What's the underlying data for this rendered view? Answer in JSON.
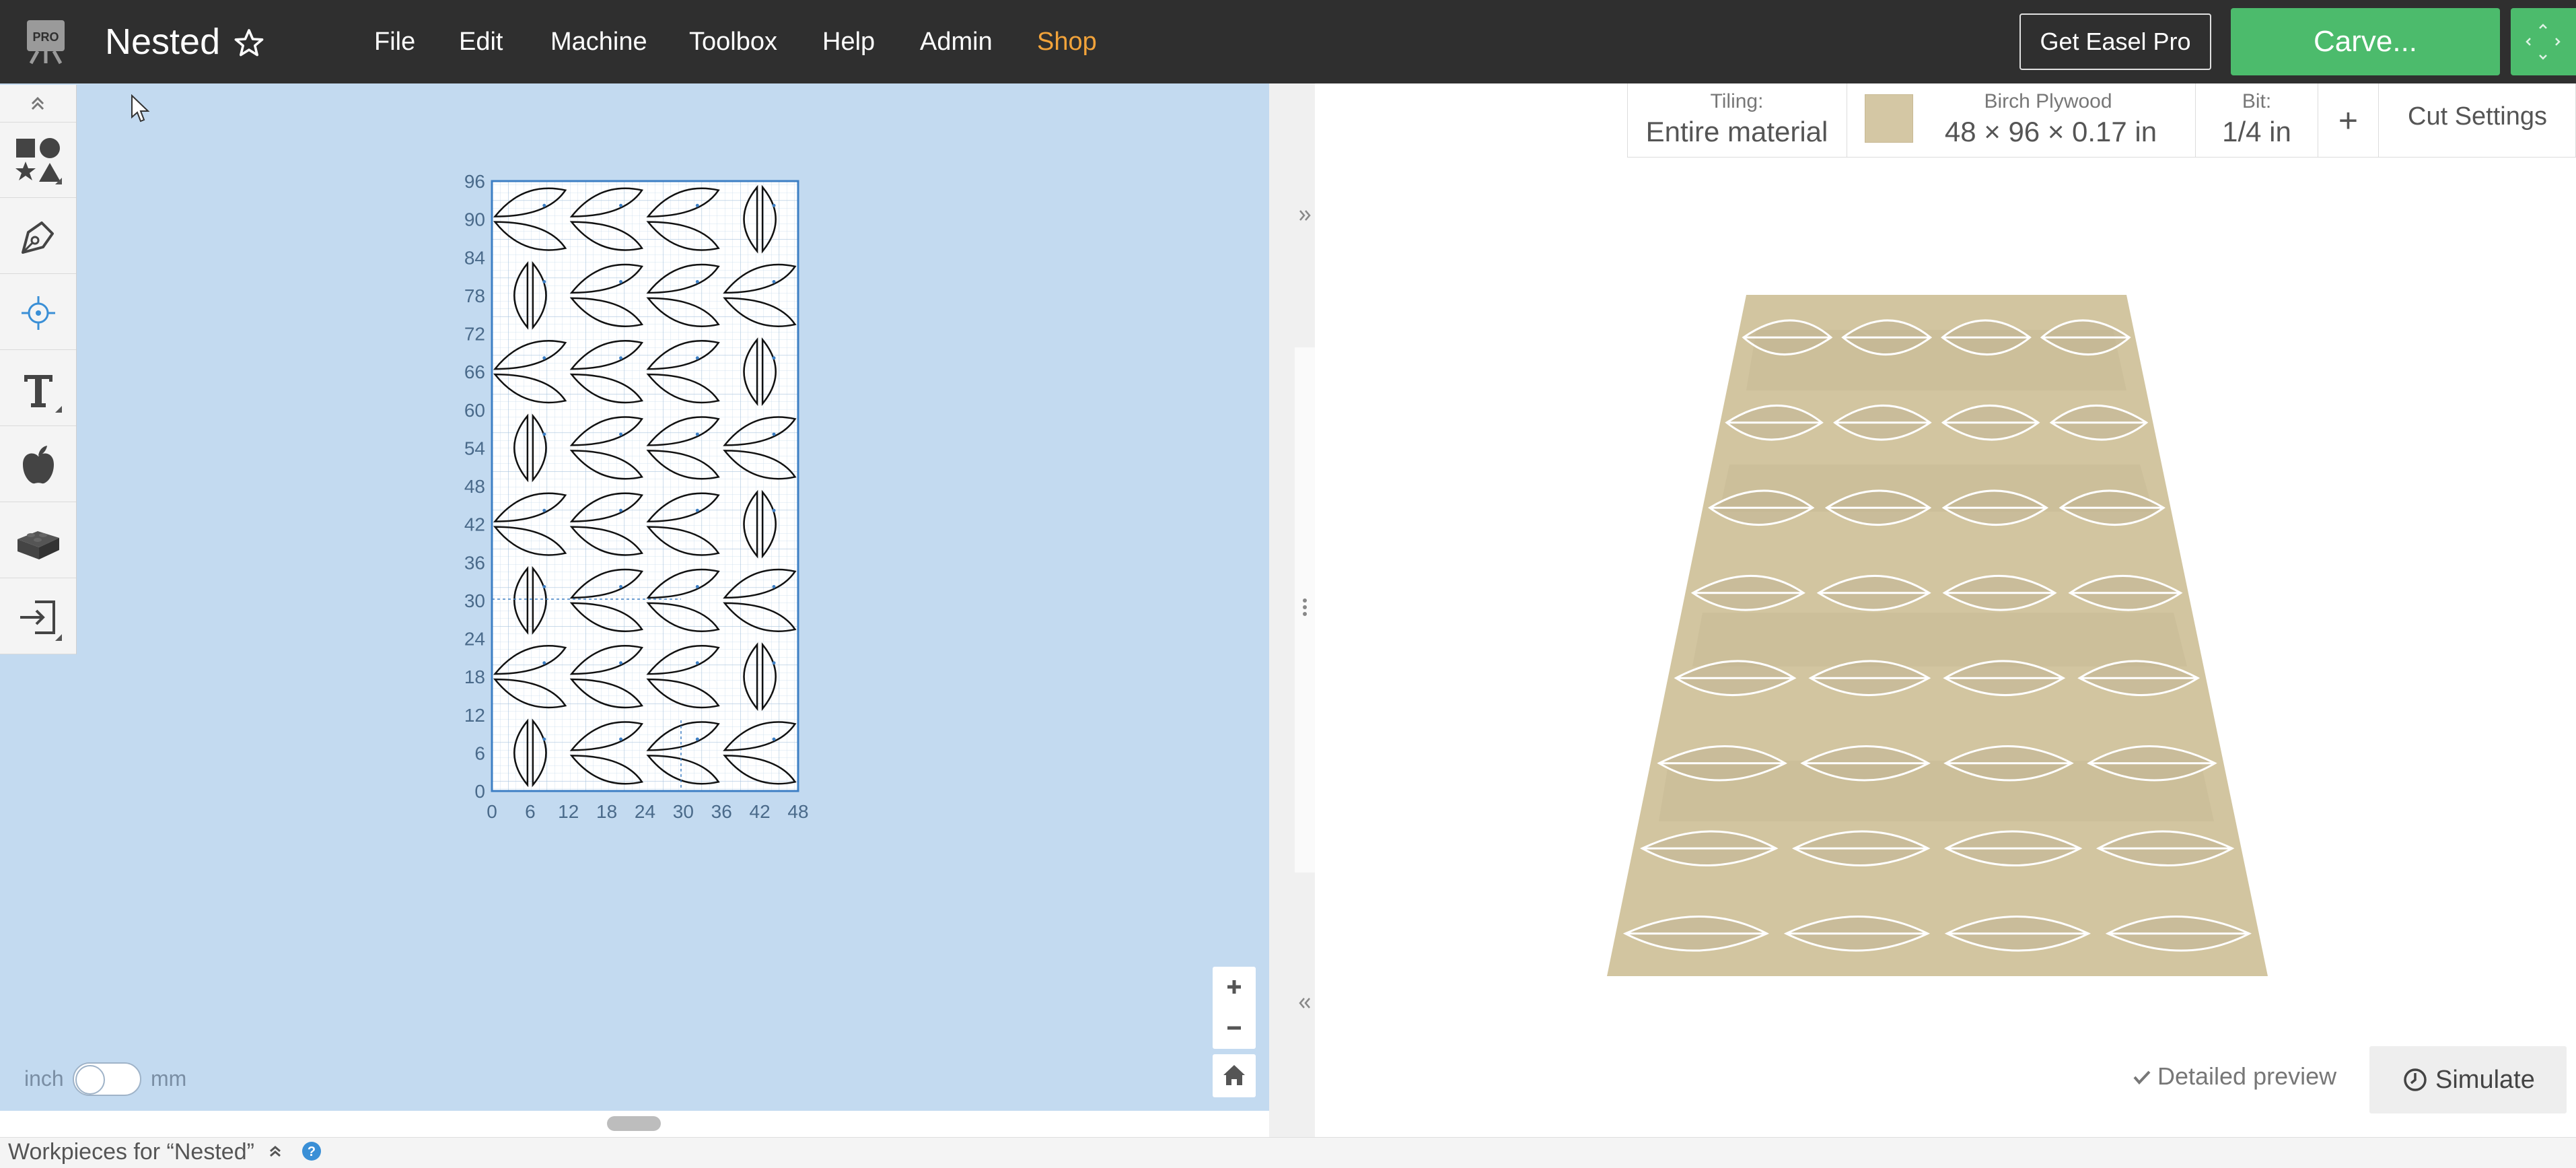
{
  "header": {
    "logo_badge": "PRO",
    "title": "Nested",
    "menu": [
      "File",
      "Edit",
      "Machine",
      "Toolbox",
      "Help",
      "Admin",
      "Shop"
    ],
    "get_pro_label": "Get Easel Pro",
    "carve_label": "Carve..."
  },
  "toolbar": {
    "tools": [
      "shapes-icon",
      "pen-icon",
      "point-icon",
      "text-icon",
      "apple-icon",
      "lego-block-icon",
      "import-icon"
    ]
  },
  "canvas": {
    "y_ticks": [
      "96",
      "90",
      "84",
      "78",
      "72",
      "66",
      "60",
      "54",
      "48",
      "42",
      "36",
      "30",
      "24",
      "18",
      "12",
      "6",
      "0"
    ],
    "x_ticks": [
      "0",
      "6",
      "12",
      "18",
      "24",
      "30",
      "36",
      "42",
      "48"
    ]
  },
  "units": {
    "left": "inch",
    "right": "mm"
  },
  "settings": {
    "tiling_label": "Tiling:",
    "tiling_value": "Entire material",
    "material_label": "Birch Plywood",
    "material_value": "48 × 96 × 0.17 in",
    "bit_label": "Bit:",
    "bit_value": "1/4 in",
    "add_label": "+",
    "cut_settings_label": "Cut Settings"
  },
  "preview": {
    "detailed_preview_label": "Detailed preview",
    "simulate_label": "Simulate"
  },
  "footer": {
    "workpieces_label": "Workpieces for “Nested”"
  },
  "colors": {
    "topbar": "#2f2f2f",
    "carve_green": "#4cbb6c",
    "shop_orange": "#f2a33a",
    "canvas_bg": "#c3daf0",
    "wood": "#d4c7a4"
  }
}
